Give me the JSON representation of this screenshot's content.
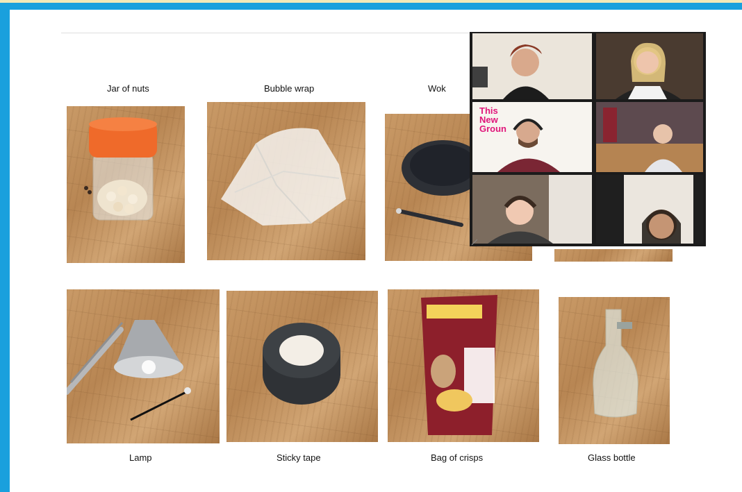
{
  "slide": {
    "items": [
      {
        "label": "Jar of nuts"
      },
      {
        "label": "Bubble wrap"
      },
      {
        "label": "Wok"
      },
      {
        "label": "Lamp"
      },
      {
        "label": "Sticky tape"
      },
      {
        "label": "Bag of crisps"
      },
      {
        "label": "Glass bottle"
      }
    ]
  },
  "video_call": {
    "logo_lines": [
      "This",
      "New",
      "Groun"
    ],
    "participant_count": 6
  },
  "colors": {
    "frame": "#1aa0dd",
    "active_speaker_border": "#c9e01d",
    "logo_pink": "#e0157a",
    "jar_lid": "#ef6a2a"
  }
}
